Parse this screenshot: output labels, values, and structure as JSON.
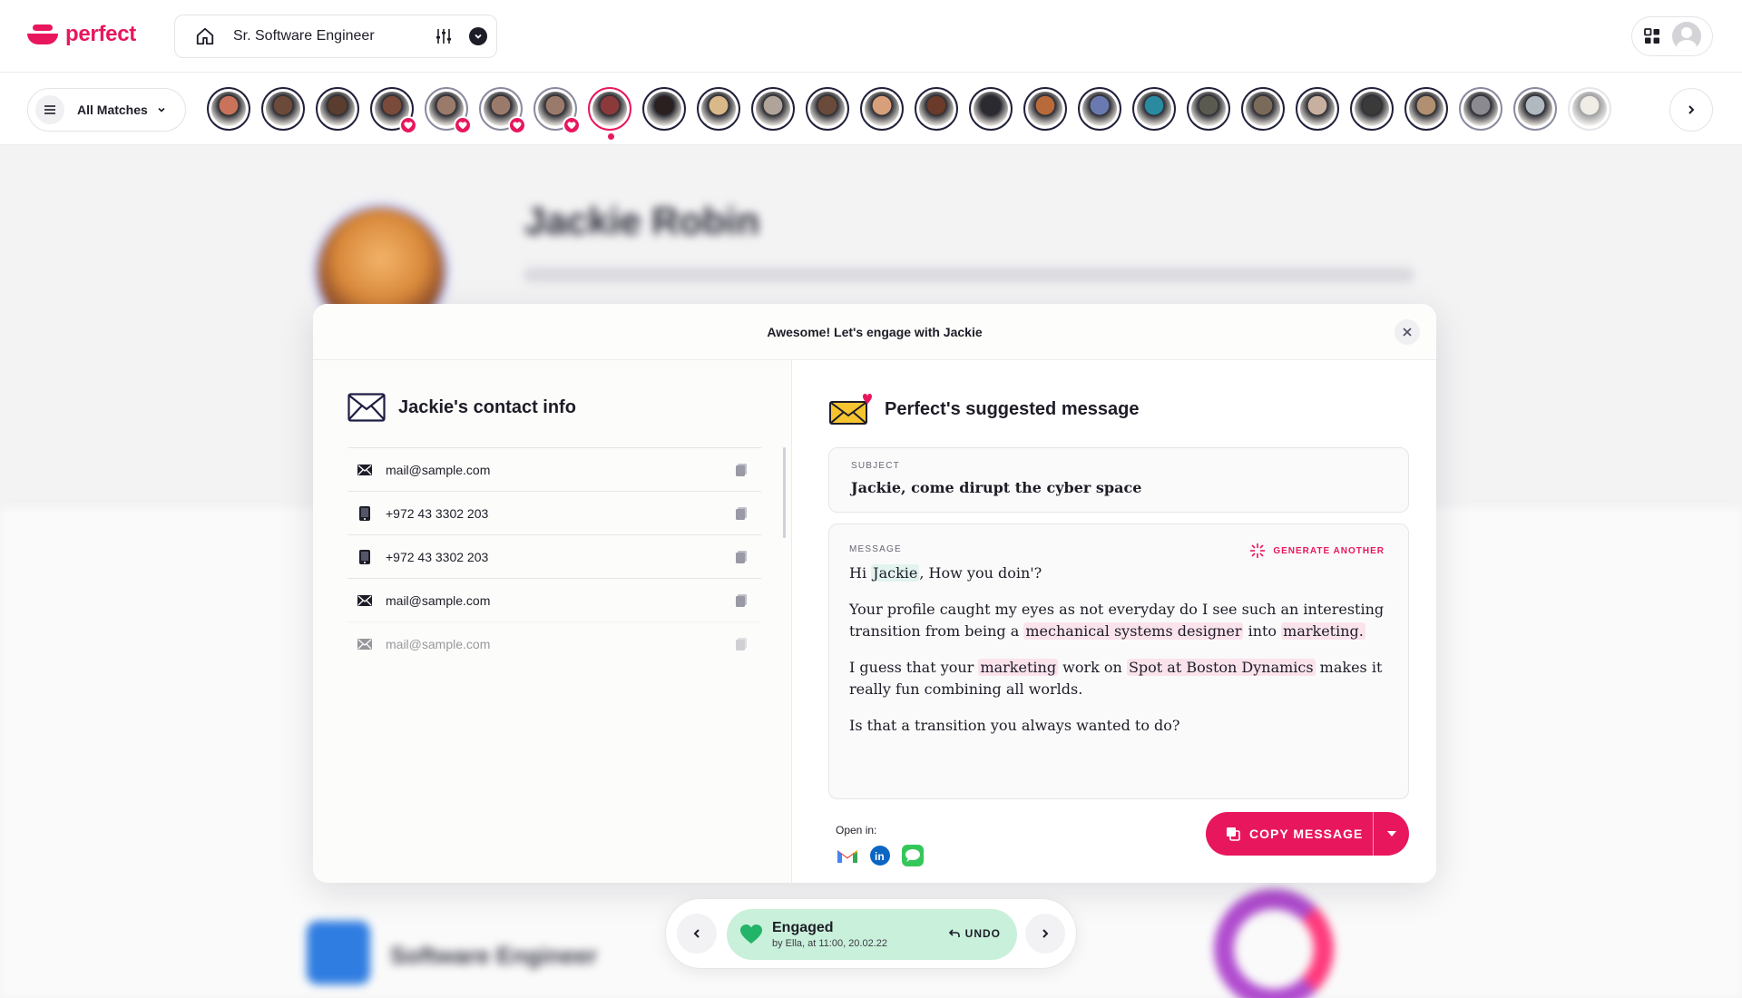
{
  "brand": {
    "name": "perfect",
    "color": "#e8175d"
  },
  "search": {
    "job_title": "Sr. Software Engineer"
  },
  "matches": {
    "filter_label": "All Matches",
    "avatars": [
      {
        "tone": "#c9735a",
        "state": "normal"
      },
      {
        "tone": "#6b4a3a",
        "state": "normal"
      },
      {
        "tone": "#5a3d2e",
        "state": "normal"
      },
      {
        "tone": "#7a4a3a",
        "state": "engaged"
      },
      {
        "tone": "#9a7a6a",
        "state": "engaged-light"
      },
      {
        "tone": "#9a7a6a",
        "state": "engaged-light"
      },
      {
        "tone": "#9a7a6a",
        "state": "engaged-light"
      },
      {
        "tone": "#8a3a3a",
        "state": "active"
      },
      {
        "tone": "#2b2020",
        "state": "normal"
      },
      {
        "tone": "#d9b98a",
        "state": "normal"
      },
      {
        "tone": "#b0a49a",
        "state": "normal"
      },
      {
        "tone": "#6a4a3a",
        "state": "normal"
      },
      {
        "tone": "#d8a07a",
        "state": "normal"
      },
      {
        "tone": "#6a3a2a",
        "state": "normal"
      },
      {
        "tone": "#2a2a30",
        "state": "normal"
      },
      {
        "tone": "#b86a3a",
        "state": "normal"
      },
      {
        "tone": "#6a7ab0",
        "state": "normal"
      },
      {
        "tone": "#2a8aa0",
        "state": "normal"
      },
      {
        "tone": "#5a5a50",
        "state": "normal"
      },
      {
        "tone": "#7a6a5a",
        "state": "normal"
      },
      {
        "tone": "#c8b0a0",
        "state": "normal"
      },
      {
        "tone": "#3a3a3a",
        "state": "normal"
      },
      {
        "tone": "#b09070",
        "state": "normal"
      },
      {
        "tone": "#8a8a90",
        "state": "light"
      },
      {
        "tone": "#b0b8c0",
        "state": "light"
      },
      {
        "tone": "#e0d8c8",
        "state": "faded"
      }
    ]
  },
  "background_profile": {
    "name": "Jackie Robin",
    "role": "Software Engineer"
  },
  "modal": {
    "title": "Awesome! Let's engage with Jackie",
    "contact": {
      "heading": "Jackie's contact info",
      "items": [
        {
          "type": "email-icon",
          "value": "mail@sample.com"
        },
        {
          "type": "phone-icon",
          "value": "+972 43 3302 203"
        },
        {
          "type": "phone-icon",
          "value": "+972 43 3302 203"
        },
        {
          "type": "email-icon",
          "value": "mail@sample.com"
        },
        {
          "type": "email-icon",
          "value": "mail@sample.com"
        }
      ]
    },
    "suggestion": {
      "heading": "Perfect's suggested message",
      "subject_label": "SUBJECT",
      "subject": "Jackie, come dirupt the cyber space",
      "message_label": "MESSAGE",
      "generate_label": "GENERATE ANOTHER",
      "greeting_pre": "Hi ",
      "greeting_name": "Jackie",
      "greeting_post": ", How you doin'?",
      "p1_a": "Your profile caught my eyes as not everyday do I see such an interesting transition from being a ",
      "p1_hl1": "mechanical systems designer",
      "p1_b": " into ",
      "p1_hl2": "marketing.",
      "p2_a": "I guess that your ",
      "p2_hl1": "marketing",
      "p2_b": " work on ",
      "p2_hl2": "Spot at Boston Dynamics",
      "p2_c": " makes it really fun combining all worlds.",
      "p3": "Is that a transition you always wanted to do?",
      "open_in_label": "Open in:",
      "open_in_apps": [
        "gmail-icon",
        "linkedin-icon",
        "messages-icon"
      ],
      "copy_label": "COPY MESSAGE"
    }
  },
  "engage": {
    "status": "Engaged",
    "by": "by Ella, at 11:00, 20.02.22",
    "undo_label": "UNDO",
    "color": "#c9f0da"
  }
}
